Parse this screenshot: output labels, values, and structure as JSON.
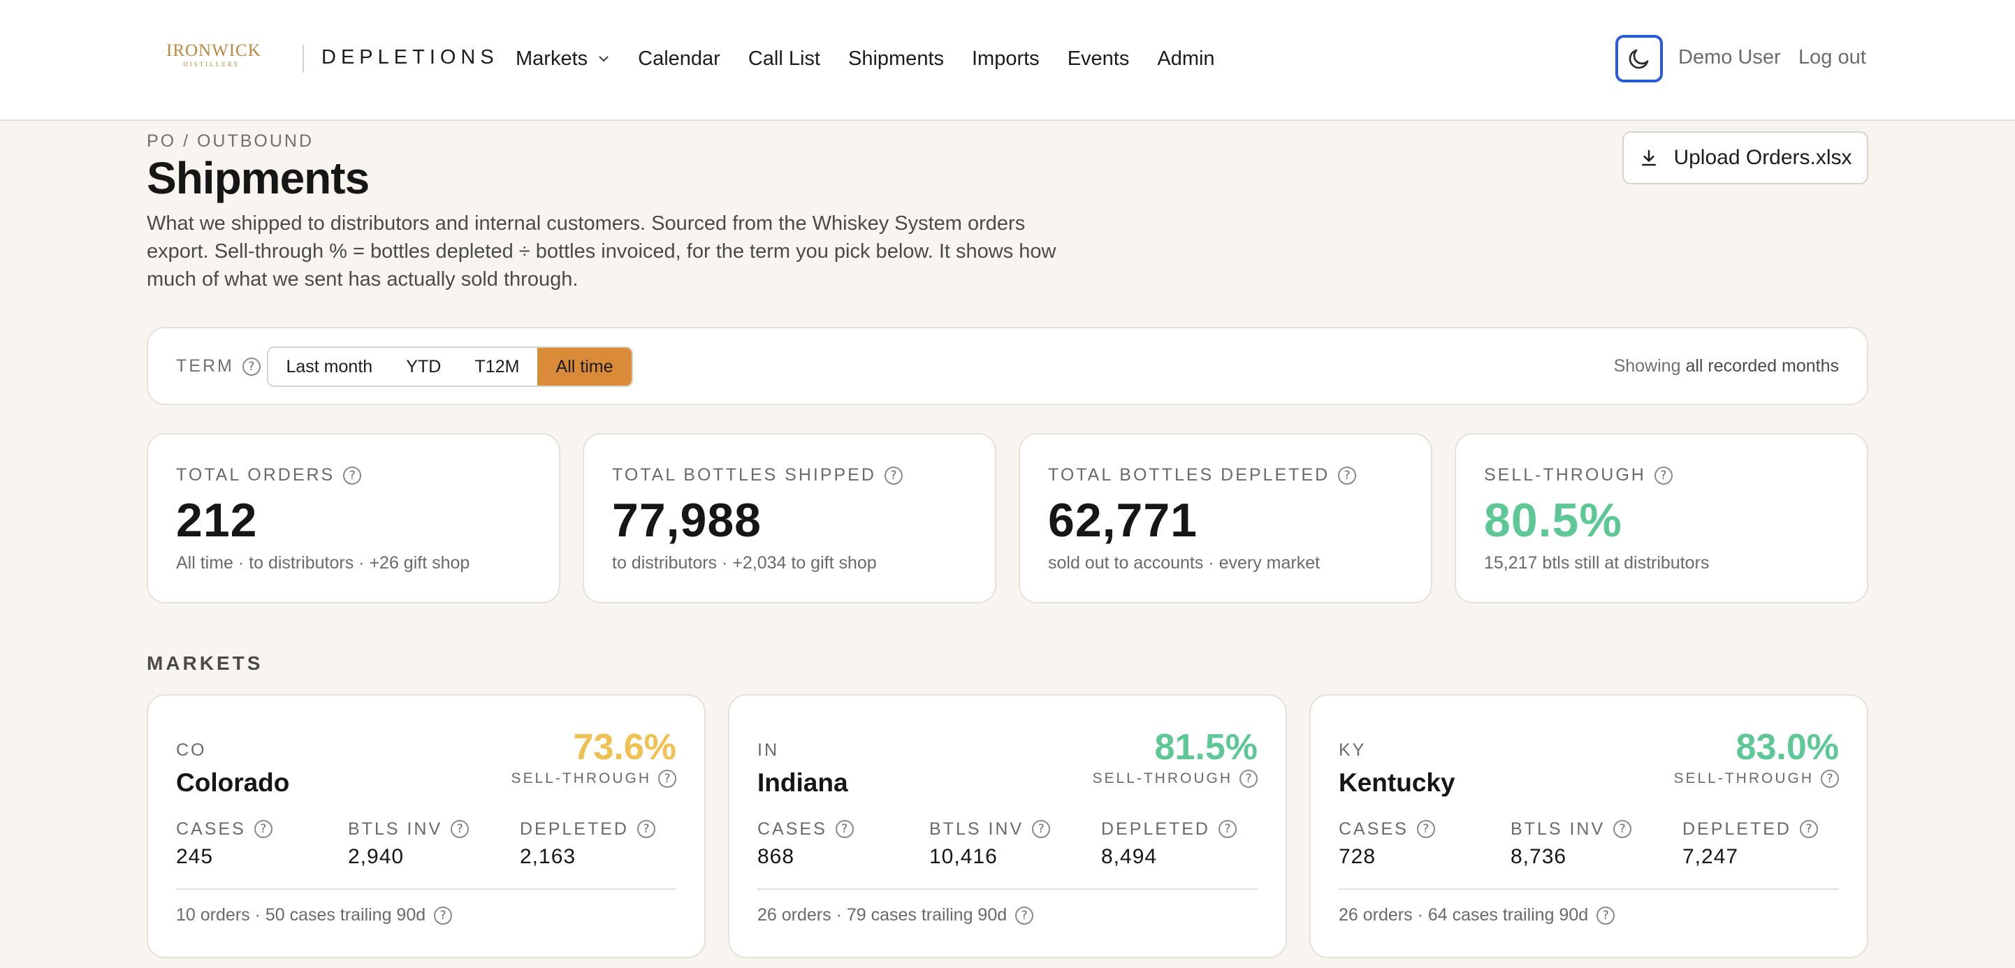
{
  "header": {
    "logo_brand": "IRONWICK",
    "logo_sub": "DISTILLERY",
    "app_name": "DEPLETIONS",
    "nav": {
      "markets": "Markets",
      "calendar": "Calendar",
      "call_list": "Call List",
      "shipments": "Shipments",
      "imports": "Imports",
      "events": "Events",
      "admin": "Admin"
    },
    "user_name": "Demo User",
    "logout": "Log out"
  },
  "page": {
    "breadcrumb": "PO / OUTBOUND",
    "title": "Shipments",
    "description": "What we shipped to distributors and internal customers. Sourced from the Whiskey System orders export. Sell-through % = bottles depleted ÷ bottles invoiced, for the term you pick below. It shows how much of what we sent has actually sold through.",
    "upload_label": "Upload Orders.xlsx"
  },
  "term": {
    "label": "TERM",
    "options": [
      "Last month",
      "YTD",
      "T12M",
      "All time"
    ],
    "selected": "All time",
    "showing_prefix": "Showing",
    "showing_value": "all recorded months"
  },
  "stats": [
    {
      "label": "TOTAL ORDERS",
      "value": "212",
      "note": "All time · to distributors · +26 gift shop"
    },
    {
      "label": "TOTAL BOTTLES SHIPPED",
      "value": "77,988",
      "note": "to distributors · +2,034 to gift shop"
    },
    {
      "label": "TOTAL BOTTLES DEPLETED",
      "value": "62,771",
      "note": "sold out to accounts · every market"
    },
    {
      "label": "SELL-THROUGH",
      "value": "80.5%",
      "note": "15,217 btls still at distributors"
    }
  ],
  "markets": {
    "heading": "MARKETS",
    "sell_through_label": "SELL-THROUGH",
    "col_cases": "CASES",
    "col_btls_inv": "BTLS INV",
    "col_depleted": "DEPLETED",
    "items": [
      {
        "code": "CO",
        "name": "Colorado",
        "sell_through": "73.6%",
        "color": "#f0c050",
        "cases": "245",
        "btls_inv": "2,940",
        "depleted": "2,163",
        "footer": "10 orders · 50 cases trailing 90d"
      },
      {
        "code": "IN",
        "name": "Indiana",
        "sell_through": "81.5%",
        "color": "#5ec796",
        "cases": "868",
        "btls_inv": "10,416",
        "depleted": "8,494",
        "footer": "26 orders · 79 cases trailing 90d"
      },
      {
        "code": "KY",
        "name": "Kentucky",
        "sell_through": "83.0%",
        "color": "#5ec796",
        "cases": "728",
        "btls_inv": "8,736",
        "depleted": "7,247",
        "footer": "26 orders · 64 cases trailing 90d"
      }
    ]
  },
  "colors": {
    "accent_selected": "#d98b3a",
    "focus_ring": "#2a5bd7",
    "good": "#5ec796",
    "warn": "#f0c050",
    "logo": "#b8893f"
  },
  "help_glyph": "?"
}
